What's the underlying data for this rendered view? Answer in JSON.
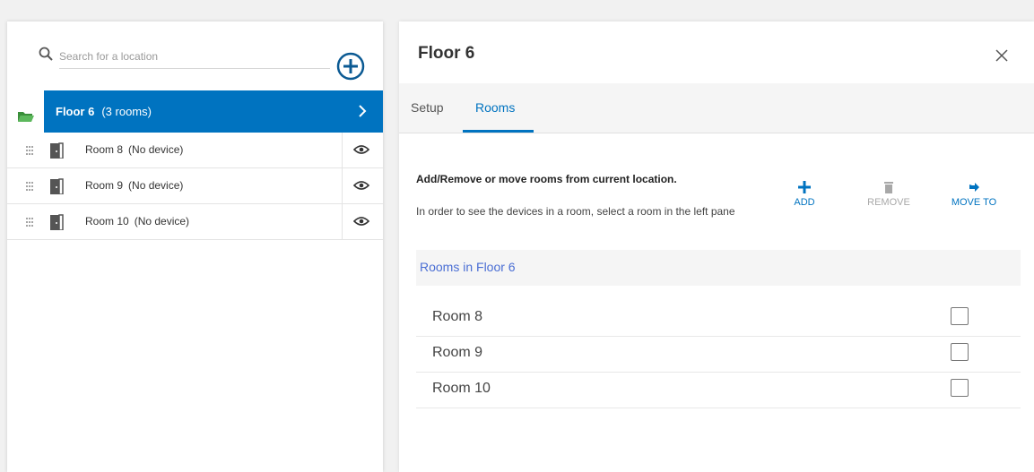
{
  "left_pane": {
    "search_placeholder": "Search for a location",
    "floor": {
      "name": "Floor 6",
      "count_label": "(3 rooms)"
    },
    "rooms": [
      {
        "name": "Room 8",
        "status": "(No device)"
      },
      {
        "name": "Room 9",
        "status": "(No device)"
      },
      {
        "name": "Room 10",
        "status": "(No device)"
      }
    ]
  },
  "detail": {
    "title": "Floor 6",
    "tabs": [
      {
        "label": "Setup",
        "active": false
      },
      {
        "label": "Rooms",
        "active": true
      }
    ],
    "heading": "Add/Remove or move rooms from current location.",
    "help": "In order to see the devices in a room, select a room in the left pane",
    "actions": {
      "add": "ADD",
      "remove": "REMOVE",
      "move": "MOVE TO"
    },
    "table_header": "Rooms in Floor 6",
    "rooms": [
      {
        "name": "Room 8",
        "checked": false
      },
      {
        "name": "Room 9",
        "checked": false
      },
      {
        "name": "Room 10",
        "checked": false
      }
    ]
  },
  "colors": {
    "accent": "#0073c0",
    "folder": "#4caf50",
    "header_link": "#4a6ed4",
    "disabled": "#a8a8a8"
  },
  "icons": [
    "search-icon",
    "add-circle-icon",
    "folder-open-icon",
    "chevron-right-icon",
    "drag-handle-icon",
    "door-icon",
    "eye-icon",
    "close-icon",
    "plus-icon",
    "trash-icon",
    "move-arrow-icon"
  ]
}
